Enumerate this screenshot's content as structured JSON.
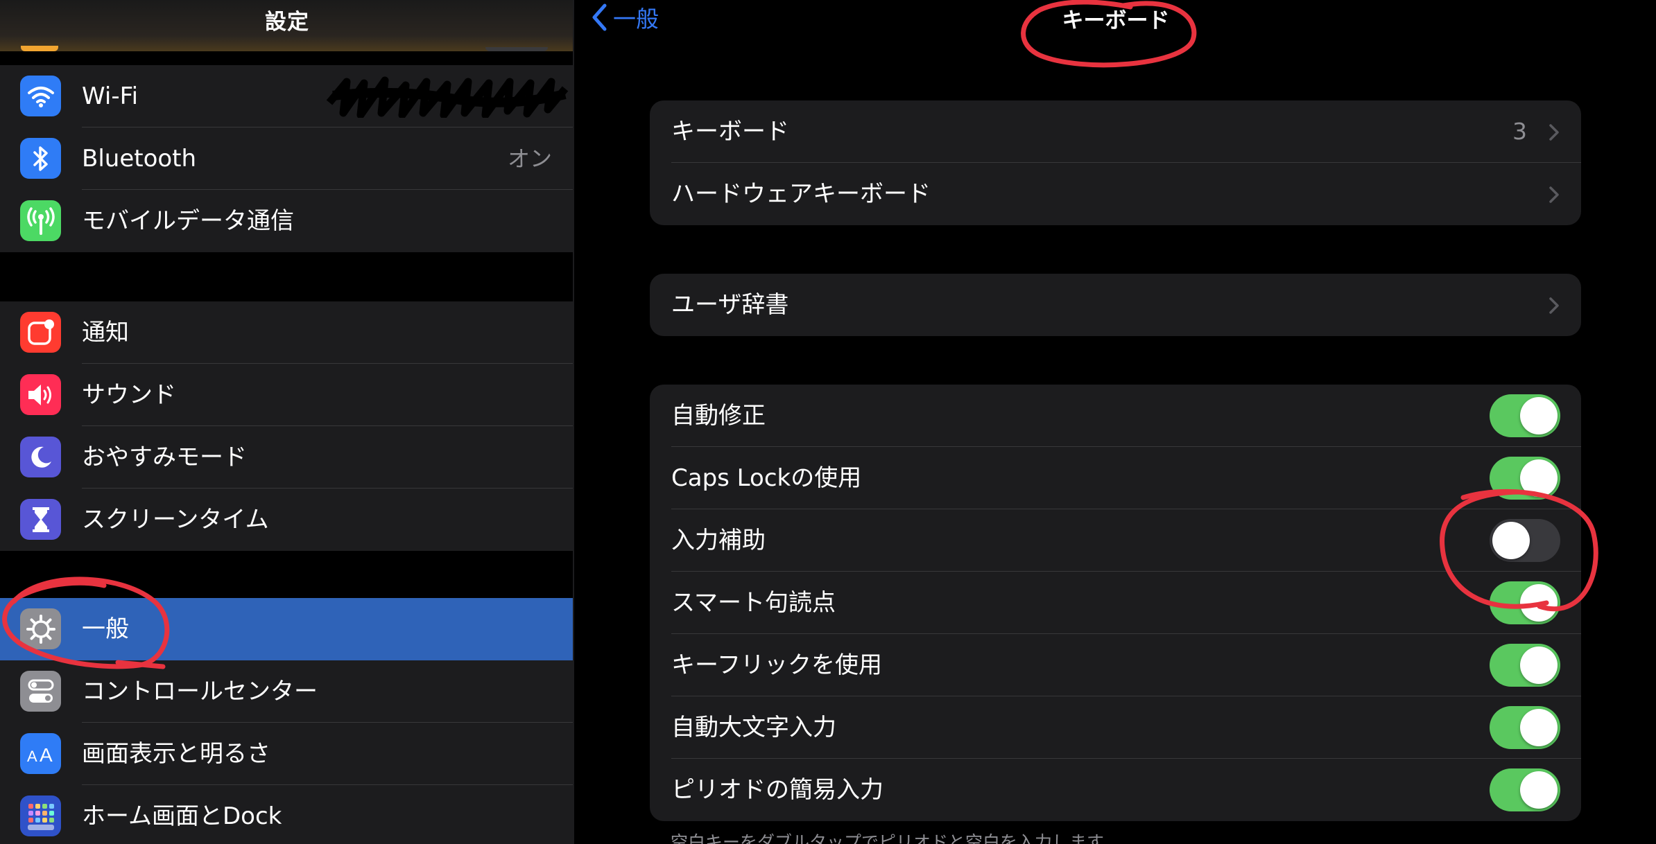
{
  "sidebar": {
    "title": "設定",
    "items": [
      {
        "label": "Wi-Fi",
        "value": "",
        "icon": "wifi-icon",
        "color": "#2f7cf6"
      },
      {
        "label": "Bluetooth",
        "value": "オン",
        "icon": "bluetooth-icon",
        "color": "#2f7cf6"
      },
      {
        "label": "モバイルデータ通信",
        "value": "",
        "icon": "antenna-icon",
        "color": "#4cd964"
      },
      {
        "label": "通知",
        "value": "",
        "icon": "notifications-icon",
        "color": "#ff3b30"
      },
      {
        "label": "サウンド",
        "value": "",
        "icon": "speaker-icon",
        "color": "#ff2d55"
      },
      {
        "label": "おやすみモード",
        "value": "",
        "icon": "moon-icon",
        "color": "#5856d6"
      },
      {
        "label": "スクリーンタイム",
        "value": "",
        "icon": "hourglass-icon",
        "color": "#5856d6"
      },
      {
        "label": "一般",
        "value": "",
        "icon": "gear-icon",
        "color": "#8e8e93",
        "selected": true
      },
      {
        "label": "コントロールセンター",
        "value": "",
        "icon": "switches-icon",
        "color": "#8e8e93"
      },
      {
        "label": "画面表示と明るさ",
        "value": "",
        "icon": "text-size-icon",
        "color": "#2f7cf6"
      },
      {
        "label": "ホーム画面とDock",
        "value": "",
        "icon": "home-grid-icon",
        "color": "#2f52c9"
      }
    ]
  },
  "detail": {
    "back_label": "一般",
    "title": "キーボード",
    "group1": [
      {
        "label": "キーボード",
        "value": "3"
      },
      {
        "label": "ハードウェアキーボード",
        "value": ""
      }
    ],
    "group2": [
      {
        "label": "ユーザ辞書"
      }
    ],
    "toggles": [
      {
        "label": "自動修正",
        "on": true
      },
      {
        "label": "Caps Lockの使用",
        "on": true
      },
      {
        "label": "入力補助",
        "on": false
      },
      {
        "label": "スマート句読点",
        "on": true
      },
      {
        "label": "キーフリックを使用",
        "on": true
      },
      {
        "label": "自動大文字入力",
        "on": true
      },
      {
        "label": "ピリオドの簡易入力",
        "on": true
      }
    ],
    "footer": "空白キーをダブルタップでピリオドと空白を入力します。"
  },
  "colors": {
    "accent": "#3478f6",
    "toggle_on": "#34c759",
    "selection": "#2f63b8",
    "annotation": "#e8333f"
  }
}
